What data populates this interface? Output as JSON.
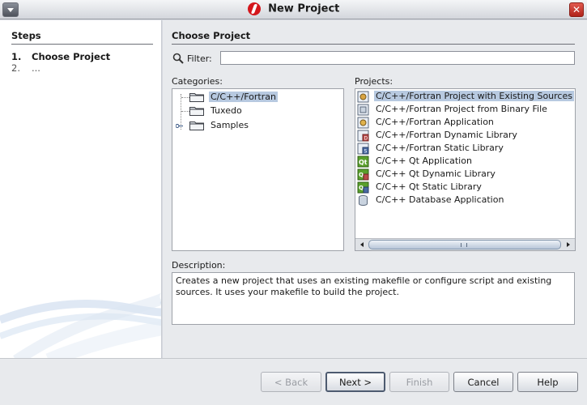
{
  "window": {
    "title": "New Project",
    "icons": {
      "menu": "window-menu-icon",
      "logo": "app-logo-icon",
      "close": "close-icon"
    }
  },
  "steps": {
    "title": "Steps",
    "items": [
      {
        "num": "1.",
        "label": "Choose Project"
      },
      {
        "num": "2.",
        "label": "..."
      }
    ]
  },
  "main": {
    "section_title": "Choose Project",
    "filter": {
      "label": "Filter:",
      "value": "",
      "placeholder": ""
    },
    "categories": {
      "label": "Categories:",
      "items": [
        {
          "label": "C/C++/Fortran",
          "selected": true
        },
        {
          "label": "Tuxedo"
        },
        {
          "label": "Samples"
        }
      ]
    },
    "projects": {
      "label": "Projects:",
      "items": [
        {
          "label": "C/C++/Fortran Project with Existing Sources",
          "icon": "project-existing-sources-icon",
          "selected": true
        },
        {
          "label": "C/C++/Fortran Project from Binary File",
          "icon": "project-binary-icon"
        },
        {
          "label": "C/C++/Fortran Application",
          "icon": "application-icon"
        },
        {
          "label": "C/C++/Fortran Dynamic Library",
          "icon": "dynamic-library-icon"
        },
        {
          "label": "C/C++/Fortran Static Library",
          "icon": "static-library-icon"
        },
        {
          "label": "C/C++ Qt Application",
          "icon": "qt-application-icon"
        },
        {
          "label": "C/C++ Qt Dynamic Library",
          "icon": "qt-dynamic-library-icon"
        },
        {
          "label": "C/C++ Qt Static Library",
          "icon": "qt-static-library-icon"
        },
        {
          "label": "C/C++ Database Application",
          "icon": "database-icon"
        }
      ]
    },
    "description": {
      "label": "Description:",
      "text": "Creates a new project that uses an existing makefile or configure script and existing sources. It uses your makefile to build the project."
    }
  },
  "buttons": {
    "back": "< Back",
    "next": "Next >",
    "finish": "Finish",
    "cancel": "Cancel",
    "help": "Help"
  },
  "colors": {
    "selection": "#b7c9e0",
    "panel": "#e8eaed",
    "close": "#c0392b",
    "logo": "#d4161c"
  }
}
